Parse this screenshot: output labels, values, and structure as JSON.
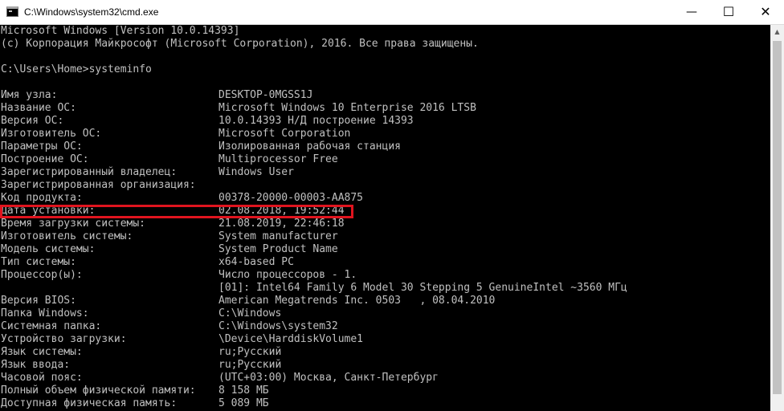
{
  "window": {
    "title": "C:\\Windows\\system32\\cmd.exe",
    "icon": "cmd-icon",
    "buttons": {
      "minimize": "—",
      "maximize": "☐",
      "close": "✕"
    }
  },
  "console": {
    "header": [
      "Microsoft Windows [Version 10.0.14393]",
      "(c) Корпорация Майкрософт (Microsoft Corporation), 2016. Все права защищены."
    ],
    "prompt": "C:\\Users\\Home>systeminfo",
    "rows": [
      {
        "label": "Имя узла:",
        "value": "DESKTOP-0MGSS1J"
      },
      {
        "label": "Название ОС:",
        "value": "Microsoft Windows 10 Enterprise 2016 LTSB"
      },
      {
        "label": "Версия ОС:",
        "value": "10.0.14393 Н/Д построение 14393"
      },
      {
        "label": "Изготовитель ОС:",
        "value": "Microsoft Corporation"
      },
      {
        "label": "Параметры ОС:",
        "value": "Изолированная рабочая станция"
      },
      {
        "label": "Построение ОС:",
        "value": "Multiprocessor Free"
      },
      {
        "label": "Зарегистрированный владелец:",
        "value": "Windows User"
      },
      {
        "label": "Зарегистрированная организация:",
        "value": ""
      },
      {
        "label": "Код продукта:",
        "value": "00378-20000-00003-AA875"
      },
      {
        "label": "Дата установки:",
        "value": "02.08.2018, 19:52:44"
      },
      {
        "label": "Время загрузки системы:",
        "value": "21.08.2019, 22:46:18"
      },
      {
        "label": "Изготовитель системы:",
        "value": "System manufacturer"
      },
      {
        "label": "Модель системы:",
        "value": "System Product Name"
      },
      {
        "label": "Тип системы:",
        "value": "x64-based PC"
      },
      {
        "label": "Процессор(ы):",
        "value": "Число процессоров - 1."
      },
      {
        "label": "",
        "value": "[01]: Intel64 Family 6 Model 30 Stepping 5 GenuineIntel ~3560 МГц"
      },
      {
        "label": "Версия BIOS:",
        "value": "American Megatrends Inc. 0503   , 08.04.2010"
      },
      {
        "label": "Папка Windows:",
        "value": "C:\\Windows"
      },
      {
        "label": "Системная папка:",
        "value": "C:\\Windows\\system32"
      },
      {
        "label": "Устройство загрузки:",
        "value": "\\Device\\HarddiskVolume1"
      },
      {
        "label": "Язык системы:",
        "value": "ru;Русский"
      },
      {
        "label": "Язык ввода:",
        "value": "ru;Русский"
      },
      {
        "label": "Часовой пояс:",
        "value": "(UTC+03:00) Москва, Санкт-Петербург"
      },
      {
        "label": "Полный объем физической памяти:",
        "value": "8 158 МБ"
      },
      {
        "label": "Доступная физическая память:",
        "value": "5 089 МБ"
      }
    ],
    "text_color": "#c0c0c0",
    "background_color": "#000000",
    "highlight_color": "#e0141e"
  },
  "scrollbar": {
    "up_icon": "▲"
  }
}
